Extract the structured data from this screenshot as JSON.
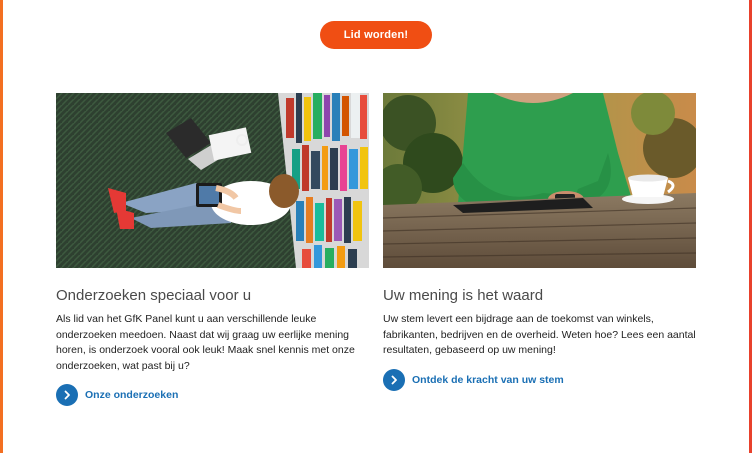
{
  "cta": {
    "label": "Lid worden!"
  },
  "cards": [
    {
      "title": "Onderzoeken speciaal voor u",
      "text": "Als lid van het GfK Panel kunt u aan verschillende leuke onderzoeken meedoen. Naast dat wij graag uw eerlijke mening horen, is onderzoek vooral ook leuk! Maak snel kennis met onze onderzoeken, wat past bij u?",
      "link": "Onze onderzoeken",
      "image": "person-reading-tablet-in-library-photo"
    },
    {
      "title": "Uw mening is het waard",
      "text": "Uw stem levert een bijdrage aan de toekomst van winkels, fabrikanten, bedrijven en de overheid. Weten hoe? Lees een aantal resultaten, gebaseerd op uw mening!",
      "link": "Ontdek de kracht van uw stem",
      "image": "person-with-phone-and-coffee-photo"
    }
  ],
  "colors": {
    "accent_orange": "#f04e13",
    "link_blue": "#1a6fb4",
    "title_gray": "#4a4a4a"
  }
}
